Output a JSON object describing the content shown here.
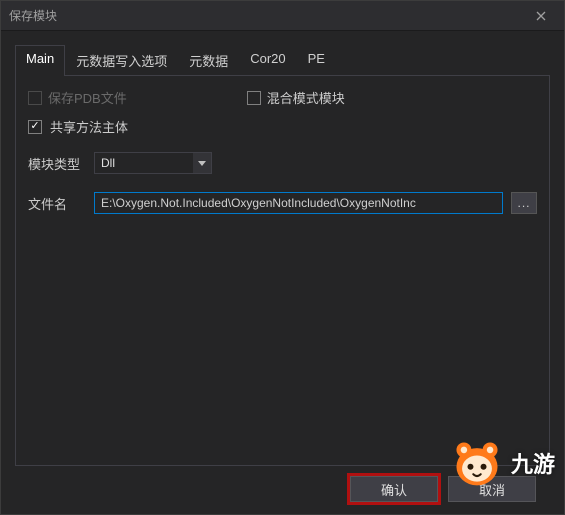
{
  "window": {
    "title": "保存模块"
  },
  "tabs": [
    {
      "label": "Main",
      "active": true
    },
    {
      "label": "元数据写入选项",
      "active": false
    },
    {
      "label": "元数据",
      "active": false
    },
    {
      "label": "Cor20",
      "active": false
    },
    {
      "label": "PE",
      "active": false
    }
  ],
  "checkboxes": {
    "save_pdb": {
      "label": "保存PDB文件",
      "checked": false,
      "enabled": false
    },
    "mixed_mode": {
      "label": "混合模式模块",
      "checked": false,
      "enabled": true
    },
    "share_method_body": {
      "label": "共享方法主体",
      "checked": true,
      "enabled": true
    }
  },
  "module_type": {
    "label": "模块类型",
    "value": "Dll"
  },
  "file_name": {
    "label": "文件名",
    "value": "E:\\Oxygen.Not.Included\\OxygenNotIncluded\\OxygenNotInc",
    "browse": "..."
  },
  "buttons": {
    "ok": "确认",
    "cancel": "取消"
  },
  "watermark": {
    "text": "九游"
  }
}
